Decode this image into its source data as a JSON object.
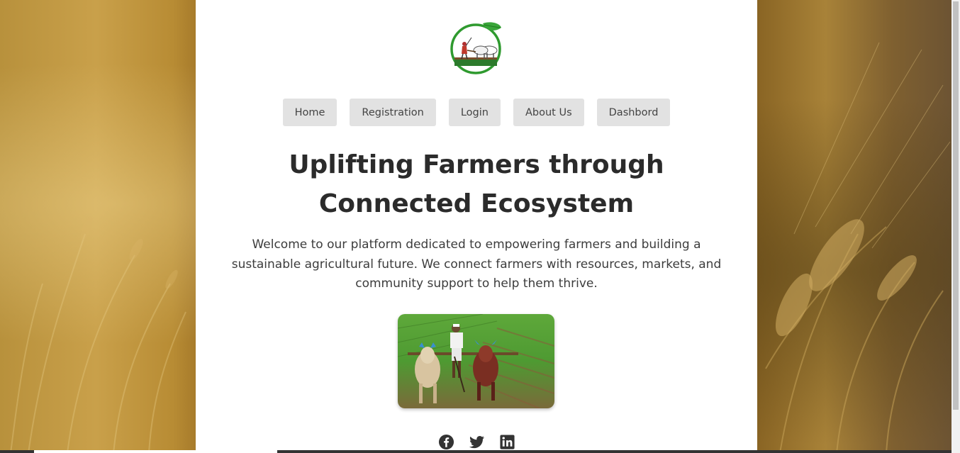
{
  "nav": {
    "items": [
      {
        "label": "Home"
      },
      {
        "label": "Registration"
      },
      {
        "label": "Login"
      },
      {
        "label": "About Us"
      },
      {
        "label": "Dashbord"
      }
    ]
  },
  "hero": {
    "title": "Uplifting Farmers through Connected Ecosystem",
    "description": "Welcome to our platform dedicated to empowering farmers and building a sustainable agricultural future. We connect farmers with resources, markets, and community support to help them thrive."
  },
  "social": {
    "icons": [
      "facebook-icon",
      "twitter-icon",
      "linkedin-icon"
    ]
  },
  "colors": {
    "card_bg": "#ffffff",
    "nav_button_bg": "#e2e2e2",
    "title_text": "#2b2b2b",
    "logo_ring": "#2f9a2f",
    "background_wheat": "#b8913c"
  }
}
